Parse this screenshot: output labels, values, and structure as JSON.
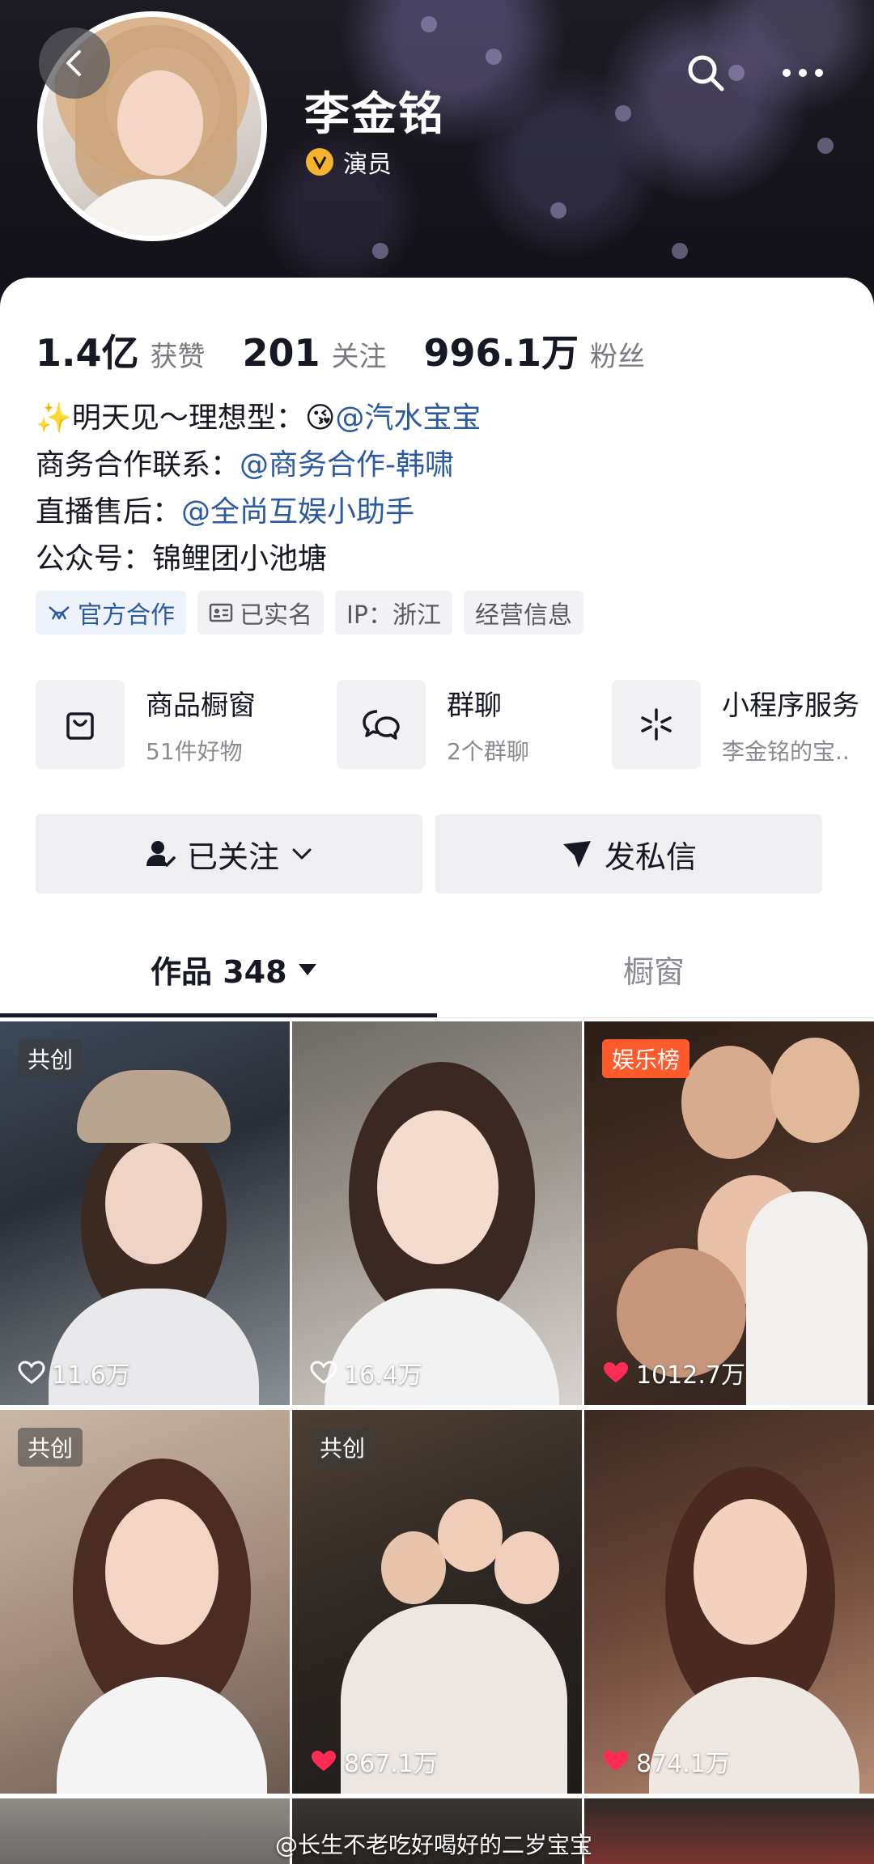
{
  "profile": {
    "name": "李金铭",
    "verify_label": "演员",
    "stats": [
      {
        "num": "1.4亿",
        "label": "获赞"
      },
      {
        "num": "201",
        "label": "关注"
      },
      {
        "num": "996.1万",
        "label": "粉丝"
      }
    ],
    "bio": {
      "line1_prefix": "✨明天见～理想型：😘",
      "line1_mention": "@汽水宝宝",
      "line2_prefix": "商务合作联系：",
      "line2_mention": "@商务合作-韩啸",
      "line3_prefix": "直播售后：",
      "line3_mention": "@全尚互娱小助手",
      "line4": "公众号：锦鲤团小池塘"
    },
    "tags": [
      "官方合作",
      "已实名",
      "IP：浙江",
      "经营信息"
    ]
  },
  "services": [
    {
      "title": "商品橱窗",
      "sub": "51件好物",
      "icon": "bag-icon"
    },
    {
      "title": "群聊",
      "sub": "2个群聊",
      "icon": "chat-bubbles-icon"
    },
    {
      "title": "小程序服务",
      "sub": "李金铭的宝..",
      "icon": "asterisk-icon"
    }
  ],
  "actions": {
    "follow_label": "已关注",
    "message_label": "发私信"
  },
  "tabs": {
    "works_label": "作品 348",
    "showcase_label": "橱窗"
  },
  "videos": [
    {
      "badge": "共创",
      "likes": "11.6万",
      "liked": false
    },
    {
      "badge": "",
      "likes": "16.4万",
      "liked": false
    },
    {
      "badge": "娱乐榜",
      "likes": "1012.7万",
      "liked": true
    },
    {
      "badge": "共创",
      "likes": "",
      "liked": false
    },
    {
      "badge": "共创",
      "likes": "867.1万",
      "liked": true
    },
    {
      "badge": "",
      "likes": "874.1万",
      "liked": true
    }
  ],
  "watermark": "@长生不老吃好喝好的二岁宝宝",
  "colors": {
    "mention": "#2c5aa0",
    "verify": "#f5b32e",
    "hot_badge": "#ff5a2c",
    "liked_heart": "#fe2c55"
  }
}
